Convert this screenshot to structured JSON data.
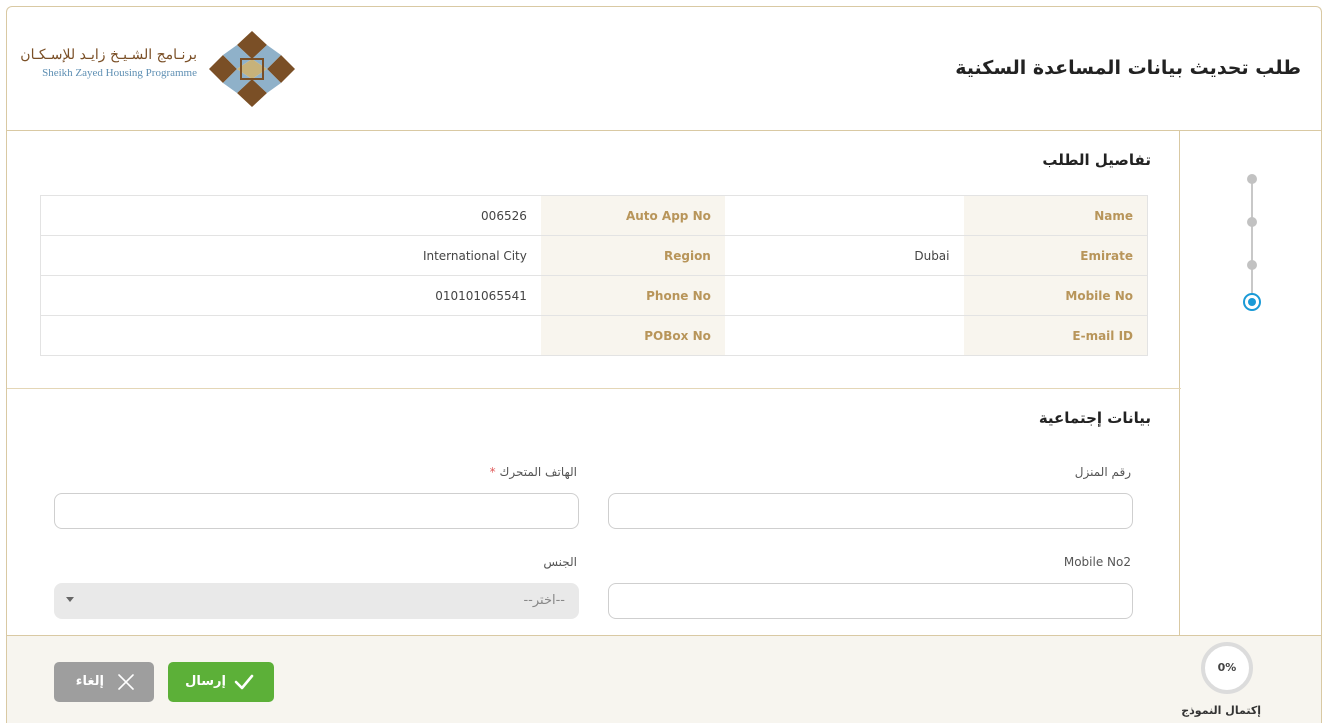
{
  "header": {
    "title": "طلب تحديث بيانات المساعدة السكنية",
    "logo_ar": "برنـامج الشـيـخ زايـد للإسـكـان",
    "logo_en": "Sheikh Zayed Housing Programme"
  },
  "details": {
    "title": "تفاصيل الطلب",
    "rows": [
      {
        "l1": "Name",
        "v1": "",
        "l2": "Auto App No",
        "v2": "006526"
      },
      {
        "l1": "Emirate",
        "v1": "Dubai",
        "l2": "Region",
        "v2": "International City"
      },
      {
        "l1": "Mobile No",
        "v1": "",
        "l2": "Phone No",
        "v2": "010101065541"
      },
      {
        "l1": "E-mail ID",
        "v1": "",
        "l2": "POBox No",
        "v2": ""
      }
    ]
  },
  "social": {
    "title": "بيانات إجتماعية",
    "house_no_label": "رقم المنزل",
    "house_no_value": "",
    "mobile_label": "الهاتف المتحرك",
    "mobile_required": "*",
    "mobile_value": "",
    "mobile2_label": "Mobile No2",
    "mobile2_value": "",
    "gender_label": "الجنس",
    "gender_selected": "--اختر--"
  },
  "footer": {
    "progress": "0%",
    "progress_label": "إكتمال النموذج",
    "submit_label": "إرسال",
    "cancel_label": "إلغاء"
  },
  "colors": {
    "accent_gold": "#b8955a",
    "border_gold": "#d9c9a3",
    "submit_green": "#5cb038",
    "cancel_grey": "#9e9e9e",
    "step_active": "#1a9ad6"
  },
  "stepper": {
    "steps": 4,
    "active_step": 4
  }
}
